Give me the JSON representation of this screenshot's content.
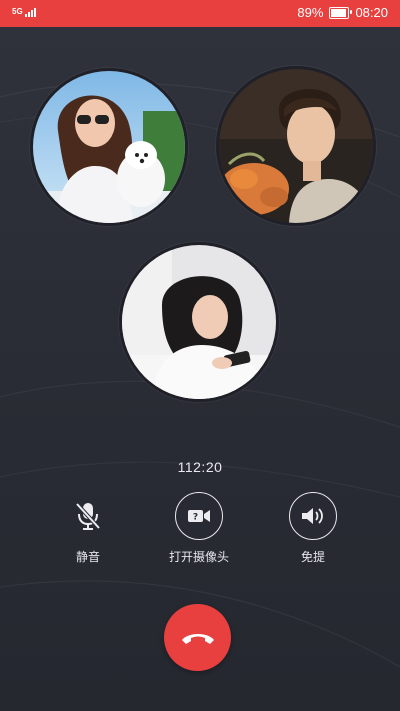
{
  "status_bar": {
    "network": "5G",
    "battery_text": "89%",
    "battery_level": 0.89,
    "time": "08:20",
    "bar_color": "#e8403f"
  },
  "call": {
    "participants": [
      {
        "id": "participant-1",
        "icon": "woman-with-dog-photo"
      },
      {
        "id": "participant-2",
        "icon": "young-man-photo"
      },
      {
        "id": "participant-3",
        "icon": "woman-on-phone-photo"
      }
    ],
    "duration": "112:20",
    "controls": {
      "mute_label": "静音",
      "camera_label": "打开摄像头",
      "speaker_label": "免提"
    },
    "hangup_icon": "phone-hangup-icon",
    "hangup_color": "#e8403f"
  }
}
